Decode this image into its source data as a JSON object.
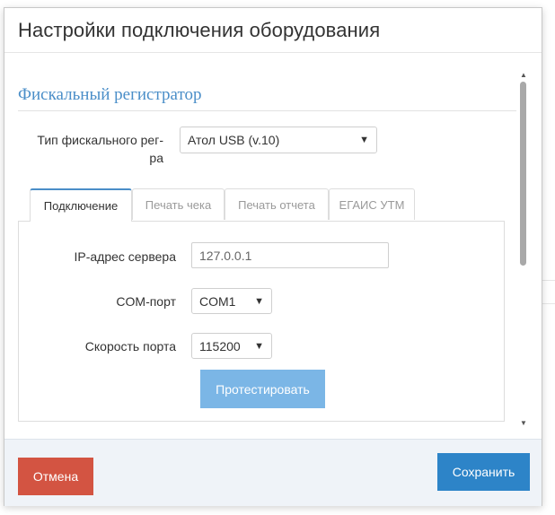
{
  "modal": {
    "title": "Настройки подключения оборудования"
  },
  "section": {
    "title": "Фискальный регистратор"
  },
  "fiscal_type": {
    "label_line1": "Тип фискального рег-",
    "label_line2": "ра",
    "value": "Атол USB (v.10)"
  },
  "tabs": [
    {
      "label": "Подключение",
      "active": true
    },
    {
      "label": "Печать чека",
      "active": false
    },
    {
      "label": "Печать отчета",
      "active": false
    },
    {
      "label": "ЕГАИС УТМ",
      "active": false
    }
  ],
  "connection": {
    "ip_label": "IP-адрес сервера",
    "ip_placeholder": "127.0.0.1",
    "com_label": "COM-порт",
    "com_value": "COM1",
    "speed_label": "Скорость порта",
    "speed_value": "115200",
    "test_button": "Протестировать"
  },
  "footer": {
    "cancel_label": "Отмена",
    "save_label": "Сохранить"
  },
  "colors": {
    "accent": "#2d84c8",
    "cancel": "#d35442",
    "test_button": "#7bb6e6",
    "section_title": "#4a8ec8"
  },
  "icons": {
    "select_arrow": "chevron-down-icon",
    "scroll_up": "scroll-up-arrow-icon",
    "scroll_down": "scroll-down-arrow-icon"
  }
}
